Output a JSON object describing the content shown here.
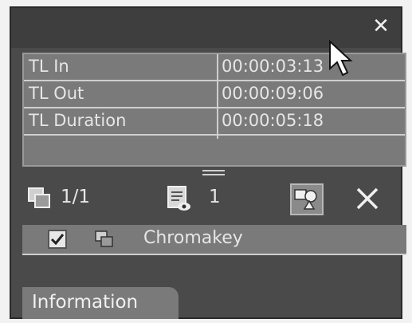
{
  "window": {
    "close_icon": "close-icon"
  },
  "info": {
    "rows": [
      {
        "label": "TL In",
        "value": "00:00:03:13"
      },
      {
        "label": "TL Out",
        "value": "00:00:09:06"
      },
      {
        "label": "TL Duration",
        "value": "00:00:05:18"
      }
    ]
  },
  "toolbar": {
    "clip_count": "1/1",
    "doc_count": "1",
    "icons": [
      "windows-icon",
      "document-view-icon",
      "effect-icon",
      "delete-icon"
    ]
  },
  "effects": {
    "items": [
      {
        "name": "Chromakey",
        "checked": true
      }
    ]
  },
  "tabs": {
    "information": "Information"
  },
  "colors": {
    "panel_bg": "#4a4a4a",
    "table_bg": "#7a7a7a",
    "text": "#e6e6e6"
  }
}
